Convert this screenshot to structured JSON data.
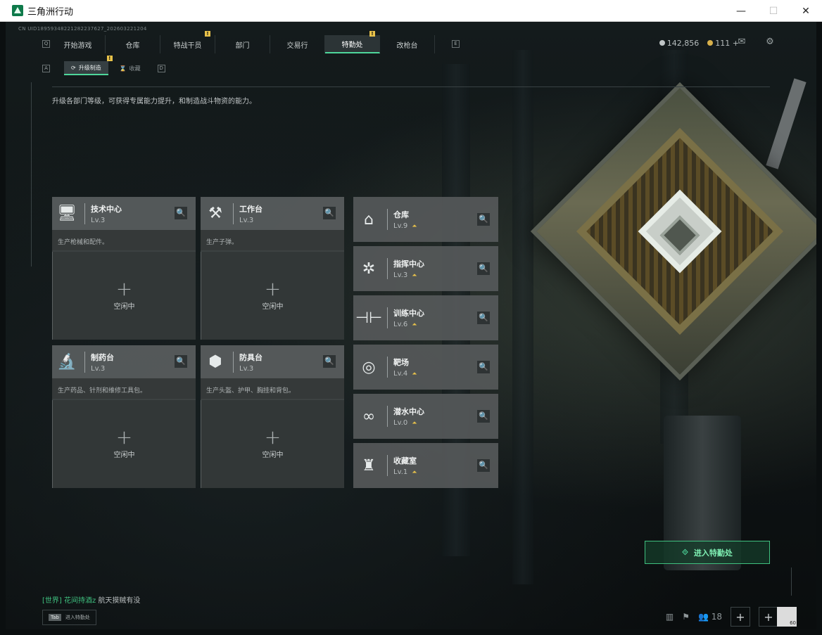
{
  "window": {
    "title": "三角洲行动",
    "minimize": "—",
    "maximize": "☐",
    "close": "✕"
  },
  "uid": "CN UID18959348221282237627_202603221204",
  "nav": {
    "left_key": "Q",
    "right_key": "E",
    "tabs": [
      {
        "label": "开始游戏",
        "badge": ""
      },
      {
        "label": "仓库",
        "badge": ""
      },
      {
        "label": "特战干员",
        "badge": "!"
      },
      {
        "label": "部门",
        "badge": ""
      },
      {
        "label": "交易行",
        "badge": ""
      },
      {
        "label": "特勤处",
        "badge": "!",
        "active": true
      },
      {
        "label": "改枪台",
        "badge": ""
      }
    ]
  },
  "currency": {
    "silver": "142,856",
    "gold": "111 +"
  },
  "subnav": {
    "left_key": "A",
    "right_key": "D",
    "tabs": [
      {
        "label": "升级制造",
        "badge": "!",
        "active": true
      },
      {
        "label": "收藏",
        "active": false
      }
    ]
  },
  "description": "升级各部门等级，可获得专属能力提升，和制造战斗物资的能力。",
  "production": [
    {
      "name": "技术中心",
      "level": "Lv.3",
      "desc": "生产枪械和配件。",
      "status": "空闲中",
      "icon": "computer-icon"
    },
    {
      "name": "工作台",
      "level": "Lv.3",
      "desc": "生产子弹。",
      "status": "空闲中",
      "icon": "tools-icon"
    },
    {
      "name": "制药台",
      "level": "Lv.3",
      "desc": "生产药品、针剂和维修工具包。",
      "status": "空闲中",
      "icon": "microscope-icon"
    },
    {
      "name": "防具台",
      "level": "Lv.3",
      "desc": "生产头盔、护甲、胸挂和背包。",
      "status": "空闲中",
      "icon": "cubes-icon"
    }
  ],
  "facilities": [
    {
      "name": "仓库",
      "level": "Lv.9",
      "icon": "warehouse-icon"
    },
    {
      "name": "指挥中心",
      "level": "Lv.3",
      "icon": "command-icon"
    },
    {
      "name": "训练中心",
      "level": "Lv.6",
      "icon": "dumbbell-icon"
    },
    {
      "name": "靶场",
      "level": "Lv.4",
      "icon": "target-icon"
    },
    {
      "name": "潜水中心",
      "level": "Lv.0",
      "icon": "diving-mask-icon"
    },
    {
      "name": "收藏室",
      "level": "Lv.1",
      "icon": "trophy-icon"
    }
  ],
  "enter_button": "进入特勤处",
  "chat": {
    "channel": "[世界]",
    "user": "花间持酒z",
    "message": "航天摸贼有没"
  },
  "tab_hint": {
    "key": "Tab",
    "label": "进入特勤处"
  },
  "online_count": "18",
  "avatar_level": "60"
}
